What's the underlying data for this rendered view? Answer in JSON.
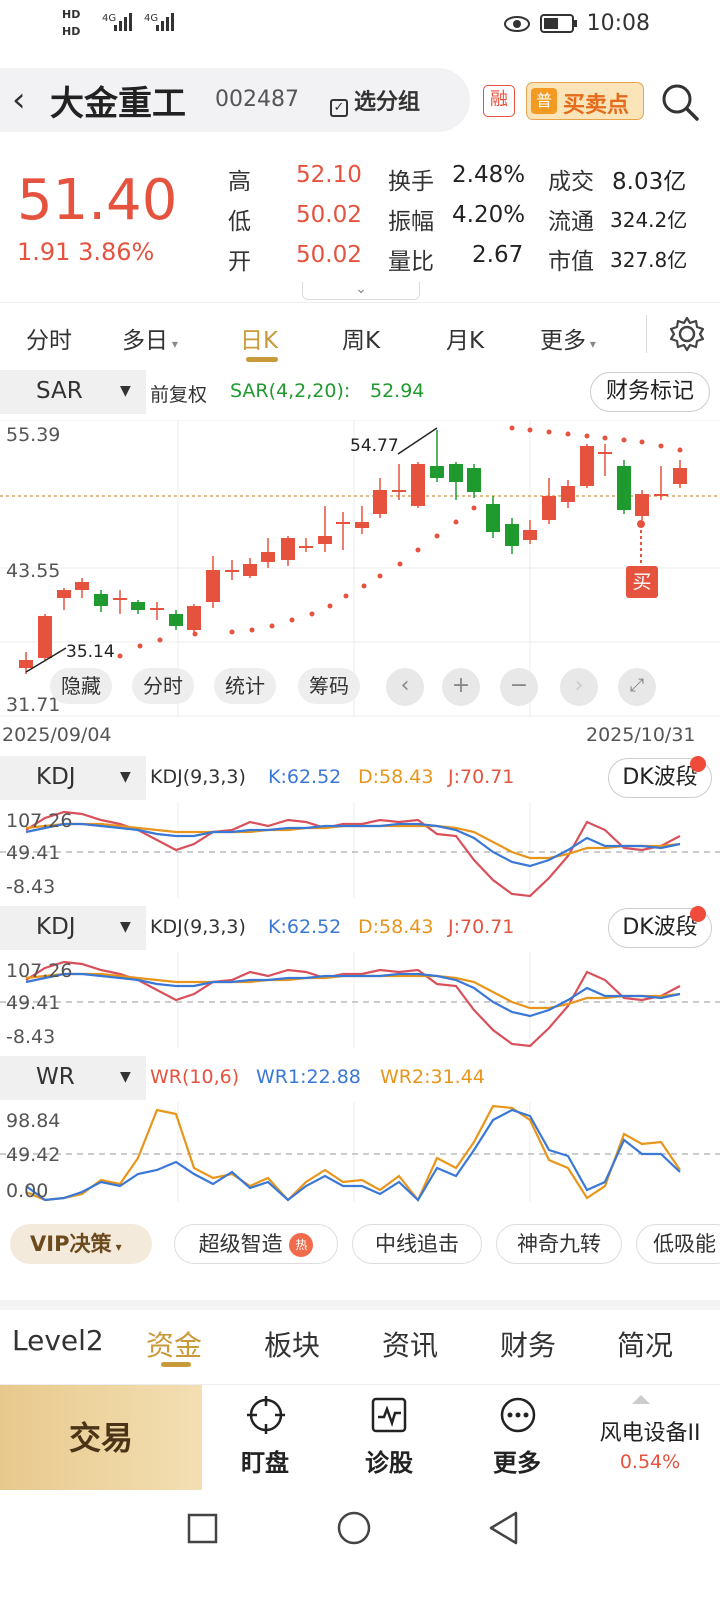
{
  "status_bar": {
    "network": "HD 4G 4G",
    "time": "10:08"
  },
  "header": {
    "stock_name": "大金重工",
    "stock_code": "002487",
    "group_button": "选分组",
    "rong_badge": "融",
    "buysell_badge_prefix": "普",
    "buysell_badge": "买卖点"
  },
  "quote": {
    "price": "51.40",
    "change": "1.91 3.86%",
    "rows": [
      {
        "l1": "高",
        "v1": "52.10",
        "l2": "换手",
        "v2": "2.48%",
        "l3": "成交",
        "v3": "8.03亿"
      },
      {
        "l1": "低",
        "v1": "50.02",
        "l2": "振幅",
        "v2": "4.20%",
        "l3": "流通",
        "v3": "324.2亿"
      },
      {
        "l1": "开",
        "v1": "50.02",
        "l2": "量比",
        "v2": "2.67",
        "l3": "市值",
        "v3": "327.8亿"
      }
    ]
  },
  "period_tabs": {
    "items": [
      "分时",
      "多日",
      "日K",
      "周K",
      "月K",
      "更多"
    ],
    "active": "日K"
  },
  "main_chart": {
    "indicator": "SAR",
    "adjust": "前复权",
    "sar_text": "SAR(4,2,20):",
    "sar_value": "52.94",
    "finance_mark_button": "财务标记",
    "y_labels": [
      "55.39",
      "43.55",
      "31.71"
    ],
    "peak_label": "54.77",
    "low_label": "35.14",
    "buy_marker": "买",
    "date_start": "2025/09/04",
    "date_end": "2025/10/31",
    "toolbar": [
      "隐藏",
      "分时",
      "统计",
      "筹码"
    ]
  },
  "kdj_1": {
    "indicator": "KDJ",
    "params": "KDJ(9,3,3)",
    "k": "K:62.52",
    "d": "D:58.43",
    "j": "J:70.71",
    "button": "DK波段",
    "y_labels": [
      "107.26",
      "49.41",
      "-8.43"
    ]
  },
  "kdj_2": {
    "indicator": "KDJ",
    "params": "KDJ(9,3,3)",
    "k": "K:62.52",
    "d": "D:58.43",
    "j": "J:70.71",
    "button": "DK波段",
    "y_labels": [
      "107.26",
      "49.41",
      "-8.43"
    ]
  },
  "wr": {
    "indicator": "WR",
    "params": "WR(10,6)",
    "wr1": "WR1:22.88",
    "wr2": "WR2:31.44",
    "y_labels": [
      "98.84",
      "49.42",
      "0.00"
    ]
  },
  "strategy": {
    "vip": "VIP决策",
    "chips": [
      "超级智造",
      "中线追击",
      "神奇九转",
      "低吸能"
    ]
  },
  "info_tabs": {
    "items": [
      "Level2",
      "资金",
      "板块",
      "资讯",
      "财务",
      "简况"
    ],
    "active": "资金"
  },
  "action_bar": {
    "trade": "交易",
    "items": [
      "盯盘",
      "诊股",
      "更多"
    ],
    "sector_name": "风电设备II",
    "sector_change": "0.54%"
  },
  "colors": {
    "up": "#e5533f",
    "down": "#1f9a2f",
    "accent": "#c99a3a",
    "k_line": "#3a78d6",
    "d_line": "#e8951c",
    "j_line": "#d9505a"
  }
}
